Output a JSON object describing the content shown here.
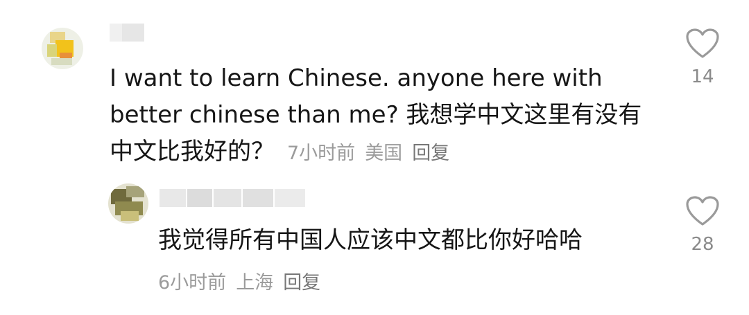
{
  "comments": [
    {
      "text": "I want to learn Chinese. anyone here with better chinese than me? 我想学中文这里有没有中文比我好的？",
      "time": "7小时前",
      "location": "美国",
      "reply_label": "回复",
      "likes": "14"
    },
    {
      "text": "我觉得所有中国人应该中文都比你好哈哈",
      "time": "6小时前",
      "location": "上海",
      "reply_label": "回复",
      "likes": "28"
    }
  ],
  "icons": {
    "like": "heart-outline-icon"
  },
  "colors": {
    "text": "#161616",
    "meta": "#9b9b9b",
    "icon": "#9a9a9a"
  }
}
